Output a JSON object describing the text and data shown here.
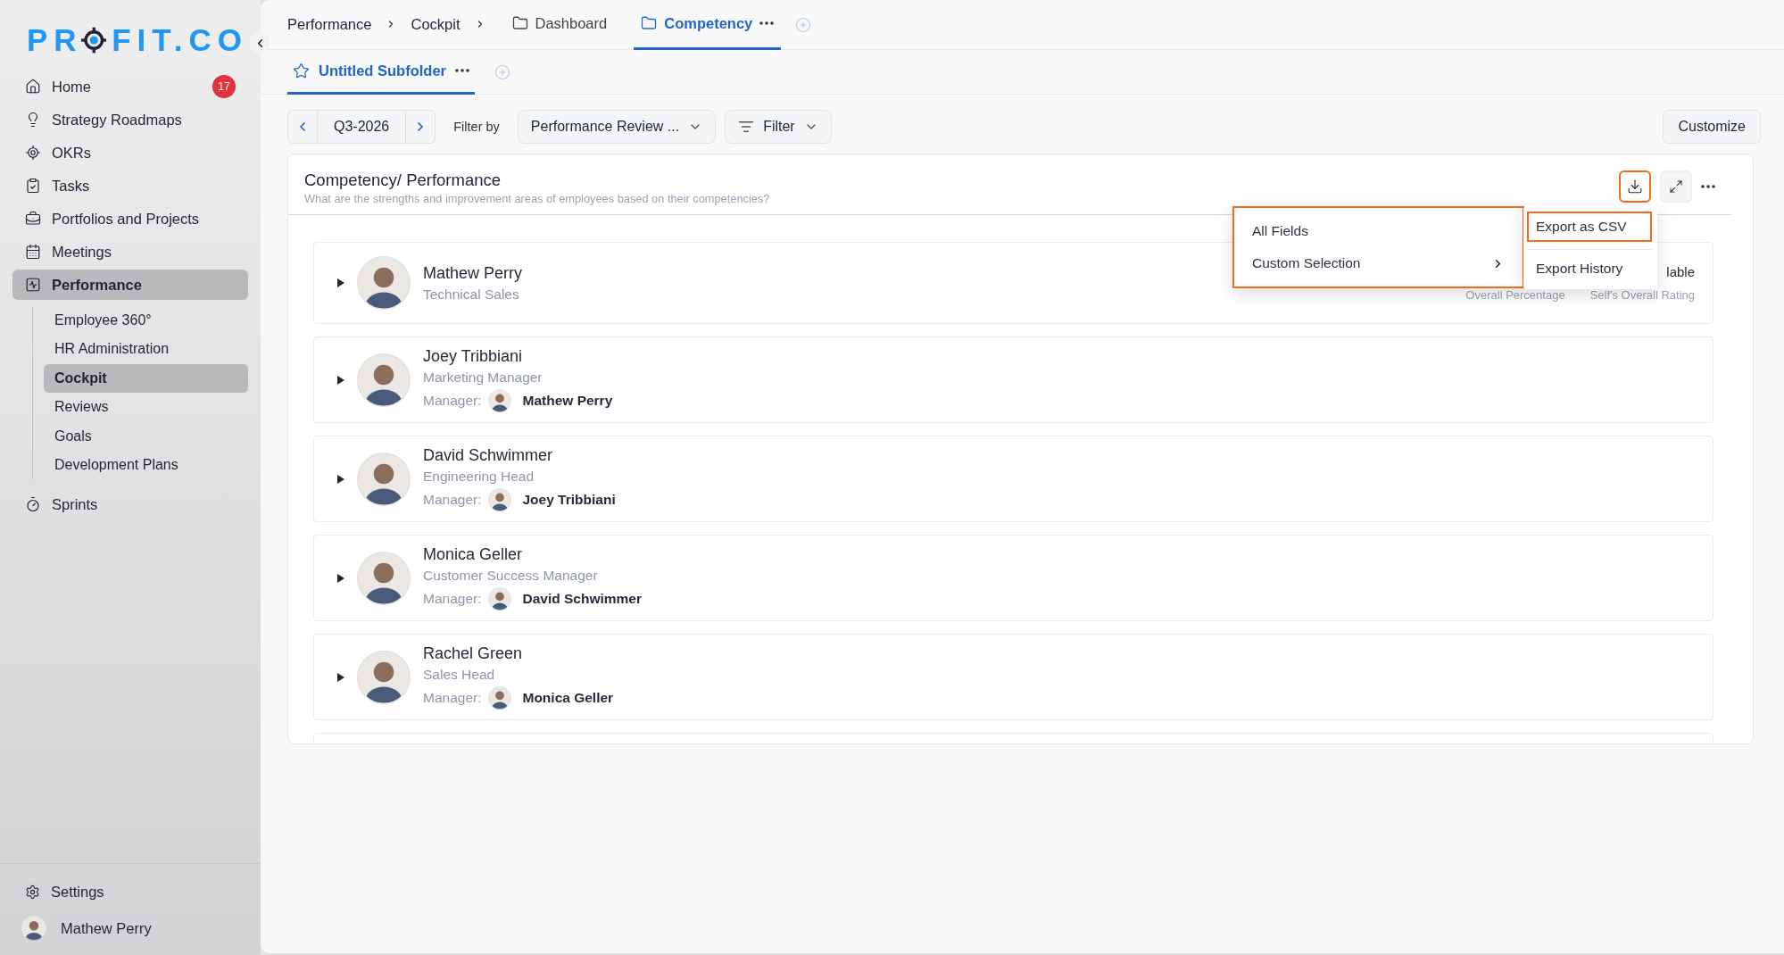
{
  "logo": {
    "before": "PR",
    "after": "FIT.CO"
  },
  "sidebar": {
    "items": [
      {
        "label": "Home",
        "badge": "17",
        "selected": false
      },
      {
        "label": "Strategy Roadmaps",
        "selected": false
      },
      {
        "label": "OKRs",
        "selected": false
      },
      {
        "label": "Tasks",
        "selected": false
      },
      {
        "label": "Portfolios and Projects",
        "selected": false
      },
      {
        "label": "Meetings",
        "selected": false
      },
      {
        "label": "Performance",
        "selected": true,
        "children": [
          {
            "label": "Employee 360°",
            "selected": false
          },
          {
            "label": "HR Administration",
            "selected": false
          },
          {
            "label": "Cockpit",
            "selected": true
          },
          {
            "label": "Reviews",
            "selected": false
          },
          {
            "label": "Goals",
            "selected": false
          },
          {
            "label": "Development Plans",
            "selected": false
          }
        ]
      },
      {
        "label": "Sprints",
        "selected": false
      }
    ],
    "settings": "Settings",
    "user": "Mathew Perry"
  },
  "breadcrumbs": [
    "Performance",
    "Cockpit"
  ],
  "folder_tabs": [
    {
      "label": "Dashboard",
      "selected": false
    },
    {
      "label": "Competency",
      "selected": true
    }
  ],
  "subfolder_tabs": [
    {
      "label": "Untitled Subfolder",
      "selected": true
    }
  ],
  "toolbar": {
    "period": "Q3-2026",
    "filter_by": "Filter by",
    "view": "Performance Review ...",
    "filter": "Filter",
    "customize": "Customize"
  },
  "card": {
    "title": "Competency/ Performance",
    "subtitle": "What are the strengths and improvement areas of employees based on their competencies?",
    "download_highlighted": true,
    "rows": [
      {
        "name": "Mathew Perry",
        "role": "Technical Sales",
        "columns": {
          "heading": "lable",
          "labels": [
            "Overall Percentage",
            "Self's Overall Rating"
          ]
        }
      },
      {
        "name": "Joey Tribbiani",
        "role": "Marketing Manager",
        "manager_label": "Manager:",
        "manager": "Mathew Perry"
      },
      {
        "name": "David Schwimmer",
        "role": "Engineering Head",
        "manager_label": "Manager:",
        "manager": "Joey Tribbiani"
      },
      {
        "name": "Monica Geller",
        "role": "Customer Success Manager",
        "manager_label": "Manager:",
        "manager": "David Schwimmer"
      },
      {
        "name": "Rachel Green",
        "role": "Sales Head",
        "manager_label": "Manager:",
        "manager": "Monica Geller"
      }
    ]
  },
  "export_menu": {
    "items": [
      {
        "label": "Export as CSV",
        "selected": true
      },
      {
        "label": "Export History",
        "selected": false
      }
    ],
    "submenu": {
      "highlighted": true,
      "items": [
        {
          "label": "All Fields",
          "kind": "action"
        },
        {
          "label": "Custom Selection",
          "kind": "submenu"
        }
      ]
    }
  }
}
